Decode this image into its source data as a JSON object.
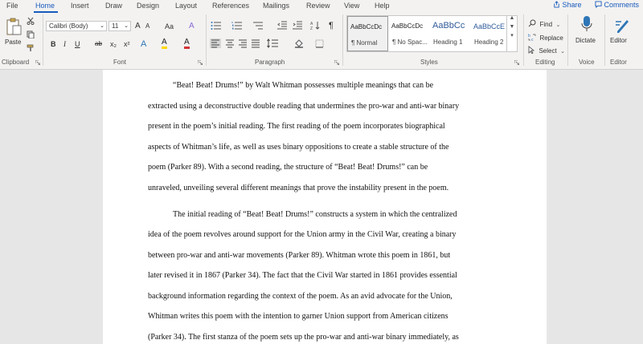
{
  "menu": {
    "tabs": [
      "File",
      "Home",
      "Insert",
      "Draw",
      "Design",
      "Layout",
      "References",
      "Mailings",
      "Review",
      "View",
      "Help"
    ],
    "share": "Share",
    "comments": "Comments"
  },
  "ribbon": {
    "clipboard": {
      "paste": "Paste",
      "label": "Clipboard"
    },
    "font": {
      "name": "Calibri (Body)",
      "size": "11",
      "label": "Font",
      "grow": "A",
      "shrink": "A",
      "case": "Aa",
      "bold": "B",
      "italic": "I",
      "underline": "U",
      "strike": "ab",
      "subscript": "x₂",
      "superscript": "x²",
      "effects": "A",
      "highlight": "A",
      "color": "A"
    },
    "paragraph": {
      "label": "Paragraph"
    },
    "styles": {
      "label": "Styles",
      "items": [
        {
          "preview": "AaBbCcDc",
          "name": "¶ Normal"
        },
        {
          "preview": "AaBbCcDc",
          "name": "¶ No Spac..."
        },
        {
          "preview": "AaBbCc",
          "name": "Heading 1"
        },
        {
          "preview": "AaBbCcE",
          "name": "Heading 2"
        }
      ]
    },
    "editing": {
      "find": "Find",
      "replace": "Replace",
      "select": "Select",
      "label": "Editing"
    },
    "voice": {
      "dictate": "Dictate",
      "label": "Voice"
    },
    "editor": {
      "editor": "Editor",
      "label": "Editor"
    },
    "colors": {
      "accent": "#185abd",
      "highlight": "#ffd800",
      "font_color": "#d13438"
    }
  },
  "document": {
    "lines": [
      "“Beat! Beat! Drums!” by Walt Whitman possesses multiple meanings that can be",
      "extracted using a deconstructive double reading that undermines the pro-war and anti-war binary",
      "present in the poem’s initial reading. The first reading of the poem incorporates biographical",
      "aspects of Whitman’s life, as well as uses binary oppositions to create a stable structure of the",
      "poem (Parker 89). With a second reading, the structure of “Beat! Beat! Drums!” can be",
      "unraveled, unveiling several different meanings that prove the instability present in the poem.",
      "The initial reading of “Beat! Beat! Drums!” constructs a system in which the centralized",
      "idea of the poem revolves around support for the Union army in the Civil War, creating a binary",
      "between pro-war and anti-war movements (Parker 89). Whitman wrote this poem in 1861, but",
      "later revised it in 1867 (Parker 34). The fact that the Civil War started in 1861 provides essential",
      "background information regarding the context of the poem. As an avid advocate for the Union,",
      "Whitman writes this poem with the intention to garner Union support from American citizens",
      "(Parker 34). The first stanza of the poem sets up the pro-war and anti-war binary immediately, as"
    ]
  }
}
